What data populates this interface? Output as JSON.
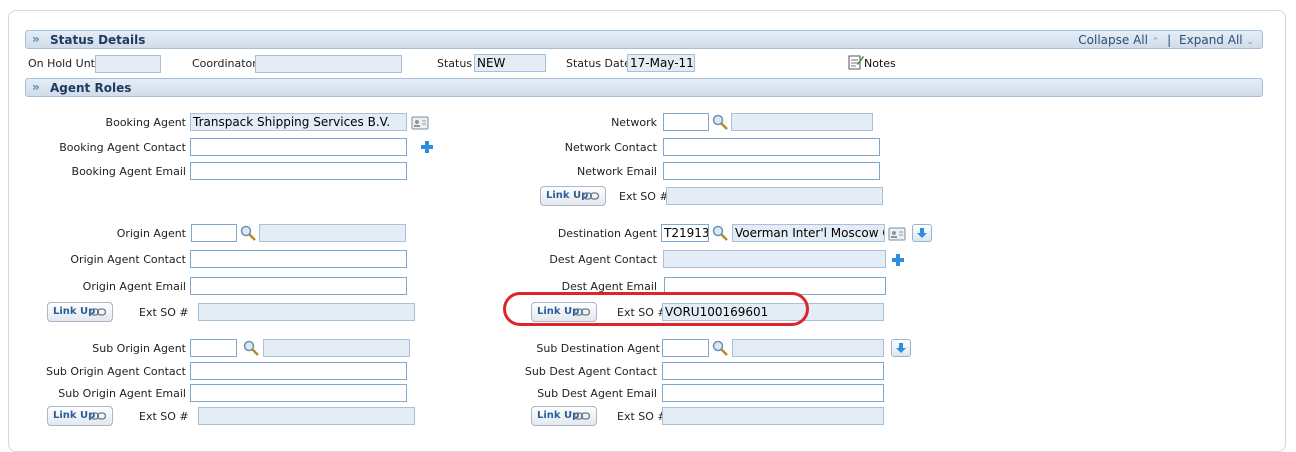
{
  "status_section": {
    "title": "Status Details",
    "collapse_all": "Collapse All",
    "separator": "|",
    "expand_all": "Expand All",
    "on_hold_until_label": "On Hold Until",
    "on_hold_until_value": "",
    "coordinator_label": "Coordinator",
    "coordinator_value": "",
    "status_label": "Status",
    "status_value": "NEW",
    "status_date_label": "Status Date",
    "status_date_value": "17-May-11",
    "notes_label": "Notes"
  },
  "agent_section": {
    "title": "Agent Roles"
  },
  "booking": {
    "agent_label": "Booking Agent",
    "agent_value": "Transpack Shipping Services B.V.",
    "contact_label": "Booking Agent Contact",
    "contact_value": "",
    "email_label": "Booking Agent Email",
    "email_value": ""
  },
  "network": {
    "label": "Network",
    "code_value": "",
    "name_value": "",
    "contact_label": "Network Contact",
    "contact_value": "",
    "email_label": "Network Email",
    "email_value": "",
    "link_up_label": "Link Up",
    "ext_so_label": "Ext SO #",
    "ext_so_value": ""
  },
  "origin": {
    "agent_label": "Origin Agent",
    "code_value": "",
    "name_value": "",
    "contact_label": "Origin Agent Contact",
    "contact_value": "",
    "email_label": "Origin Agent Email",
    "email_value": "",
    "link_up_label": "Link Up",
    "ext_so_label": "Ext SO #",
    "ext_so_value": ""
  },
  "destination": {
    "agent_label": "Destination Agent",
    "code_value": "T21913",
    "name_value": "Voerman Inter'l Moscow OO",
    "contact_label": "Dest Agent Contact",
    "contact_value": "",
    "email_label": "Dest Agent Email",
    "email_value": "",
    "link_up_label": "Link Up",
    "ext_so_label": "Ext SO #",
    "ext_so_value": "VORU100169601"
  },
  "sub_origin": {
    "agent_label": "Sub Origin Agent",
    "code_value": "",
    "name_value": "",
    "contact_label": "Sub Origin Agent Contact",
    "contact_value": "",
    "email_label": "Sub Origin Agent Email",
    "email_value": "",
    "link_up_label": "Link Up",
    "ext_so_label": "Ext SO #",
    "ext_so_value": ""
  },
  "sub_destination": {
    "agent_label": "Sub Destination Agent",
    "code_value": "",
    "name_value": "",
    "contact_label": "Sub Dest Agent Contact",
    "contact_value": "",
    "email_label": "Sub Dest Agent Email",
    "email_value": "",
    "link_up_label": "Link Up",
    "ext_so_label": "Ext SO #",
    "ext_so_value": ""
  },
  "icons": {
    "search": "search-icon",
    "card": "address-card-icon",
    "add": "add-plus-icon",
    "download": "arrow-down-icon",
    "link": "chain-link-icon",
    "notes": "notes-icon"
  },
  "colors": {
    "header_bg": "#d6e2ef",
    "input_border": "#7fa7cf",
    "readonly_bg": "#e4edf6",
    "highlight": "#e0242b"
  }
}
